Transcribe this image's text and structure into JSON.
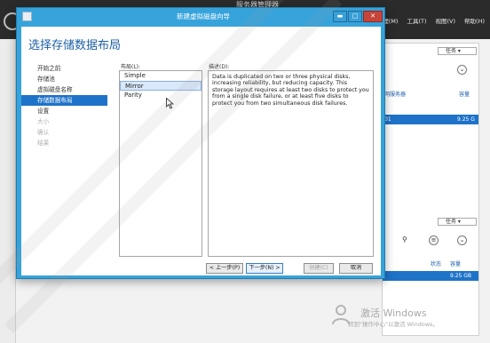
{
  "server_manager": {
    "title": "服务器管理器",
    "menu": [
      "管理(M)",
      "工具(T)",
      "视图(V)",
      "帮助(H)"
    ],
    "task_label_1": "任务",
    "task_label_2": "任务",
    "col_server": "网服务器",
    "col_capacity": "容量",
    "row_id": "01",
    "row_capacity": "9.25 G",
    "col_status": "状态",
    "col_capacity_2": "容量",
    "row2_capacity": "9.25 GB"
  },
  "dialog": {
    "title": "新建虚拟磁盘向导",
    "heading": "选择存储数据布局",
    "steps": [
      {
        "label": "开始之前",
        "state": "normal"
      },
      {
        "label": "存储池",
        "state": "normal"
      },
      {
        "label": "虚拟磁盘名称",
        "state": "normal"
      },
      {
        "label": "存储数据布局",
        "state": "active"
      },
      {
        "label": "设置",
        "state": "normal"
      },
      {
        "label": "大小",
        "state": "disabled"
      },
      {
        "label": "确认",
        "state": "disabled"
      },
      {
        "label": "结果",
        "state": "disabled"
      }
    ],
    "layout_label": "布局(L):",
    "layouts": [
      "Simple",
      "Mirror",
      "Parity"
    ],
    "selected_layout": "Mirror",
    "description_label": "描述(D):",
    "description": "Data is duplicated on two or three physical disks, increasing reliability, but reducing capacity. This storage layout requires at least two disks to protect you from a single disk failure, or at least five disks to protect you from two simultaneous disk failures.",
    "buttons": {
      "previous": "< 上一步(P)",
      "next": "下一步(N) >",
      "create": "创建(C)",
      "cancel": "取消"
    }
  },
  "activation": {
    "title": "激活 Windows",
    "subtitle": "转到\"操作中心\"以激活 Windows。"
  }
}
